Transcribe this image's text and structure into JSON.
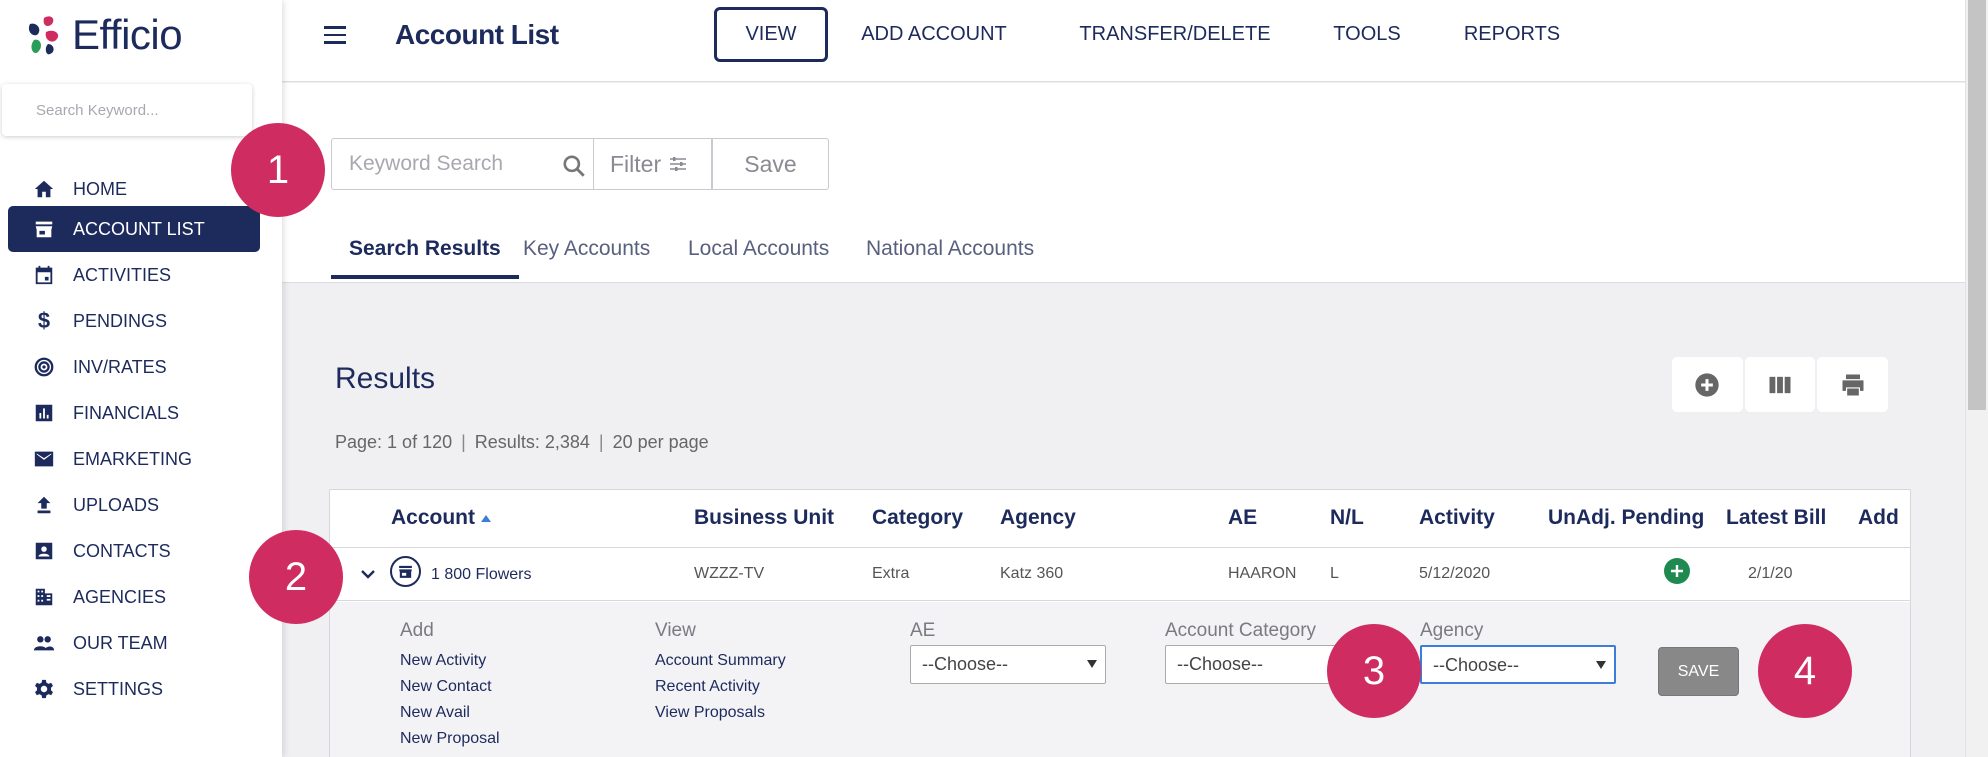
{
  "app": {
    "name": "Efficio"
  },
  "sidebar": {
    "search_placeholder": "Search Keyword...",
    "items": [
      {
        "label": "HOME",
        "icon": "home-icon"
      },
      {
        "label": "ACCOUNT LIST",
        "icon": "store-icon",
        "active": true
      },
      {
        "label": "ACTIVITIES",
        "icon": "calendar-icon"
      },
      {
        "label": "PENDINGS",
        "icon": "dollar-icon"
      },
      {
        "label": "INV/RATES",
        "icon": "target-icon"
      },
      {
        "label": "FINANCIALS",
        "icon": "bar-chart-icon"
      },
      {
        "label": "EMARKETING",
        "icon": "mail-icon"
      },
      {
        "label": "UPLOADS",
        "icon": "upload-icon"
      },
      {
        "label": "CONTACTS",
        "icon": "contact-card-icon"
      },
      {
        "label": "AGENCIES",
        "icon": "building-icon"
      },
      {
        "label": "OUR TEAM",
        "icon": "people-icon"
      },
      {
        "label": "SETTINGS",
        "icon": "gear-icon"
      }
    ]
  },
  "header": {
    "title": "Account List",
    "nav": [
      {
        "label": "VIEW",
        "active": true
      },
      {
        "label": "ADD ACCOUNT"
      },
      {
        "label": "TRANSFER/DELETE"
      },
      {
        "label": "TOOLS"
      },
      {
        "label": "REPORTS"
      }
    ]
  },
  "search": {
    "keyword_placeholder": "Keyword Search",
    "filter_label": "Filter",
    "save_label": "Save"
  },
  "tabs": [
    {
      "label": "Search Results",
      "active": true
    },
    {
      "label": "Key Accounts"
    },
    {
      "label": "Local Accounts"
    },
    {
      "label": "National Accounts"
    }
  ],
  "results": {
    "title": "Results",
    "page": "Page: 1 of 120",
    "count": "Results: 2,384",
    "per_page": "20 per page"
  },
  "table": {
    "columns": [
      "Account",
      "Business Unit",
      "Category",
      "Agency",
      "AE",
      "N/L",
      "Activity",
      "UnAdj. Pending",
      "Latest Bill",
      "Add"
    ],
    "rows": [
      {
        "account": "1 800 Flowers",
        "business_unit": "WZZZ-TV",
        "category": "Extra",
        "agency": "Katz 360",
        "ae": "HAARON",
        "nl": "L",
        "activity": "5/12/2020",
        "latest_bill": "2/1/20"
      }
    ]
  },
  "expand": {
    "add_heading": "Add",
    "add_links": [
      "New Activity",
      "New Contact",
      "New Avail",
      "New Proposal"
    ],
    "view_heading": "View",
    "view_links": [
      "Account Summary",
      "Recent Activity",
      "View Proposals"
    ],
    "ae_label": "AE",
    "ae_value": "--Choose--",
    "category_label": "Account Category",
    "category_value": "--Choose--",
    "agency_label": "Agency",
    "agency_value": "--Choose--",
    "save_label": "SAVE"
  },
  "annotations": [
    "1",
    "2",
    "3",
    "4"
  ],
  "colors": {
    "navy": "#1d2a5c",
    "annotation": "#cf2c61",
    "green": "#1f8a50"
  }
}
